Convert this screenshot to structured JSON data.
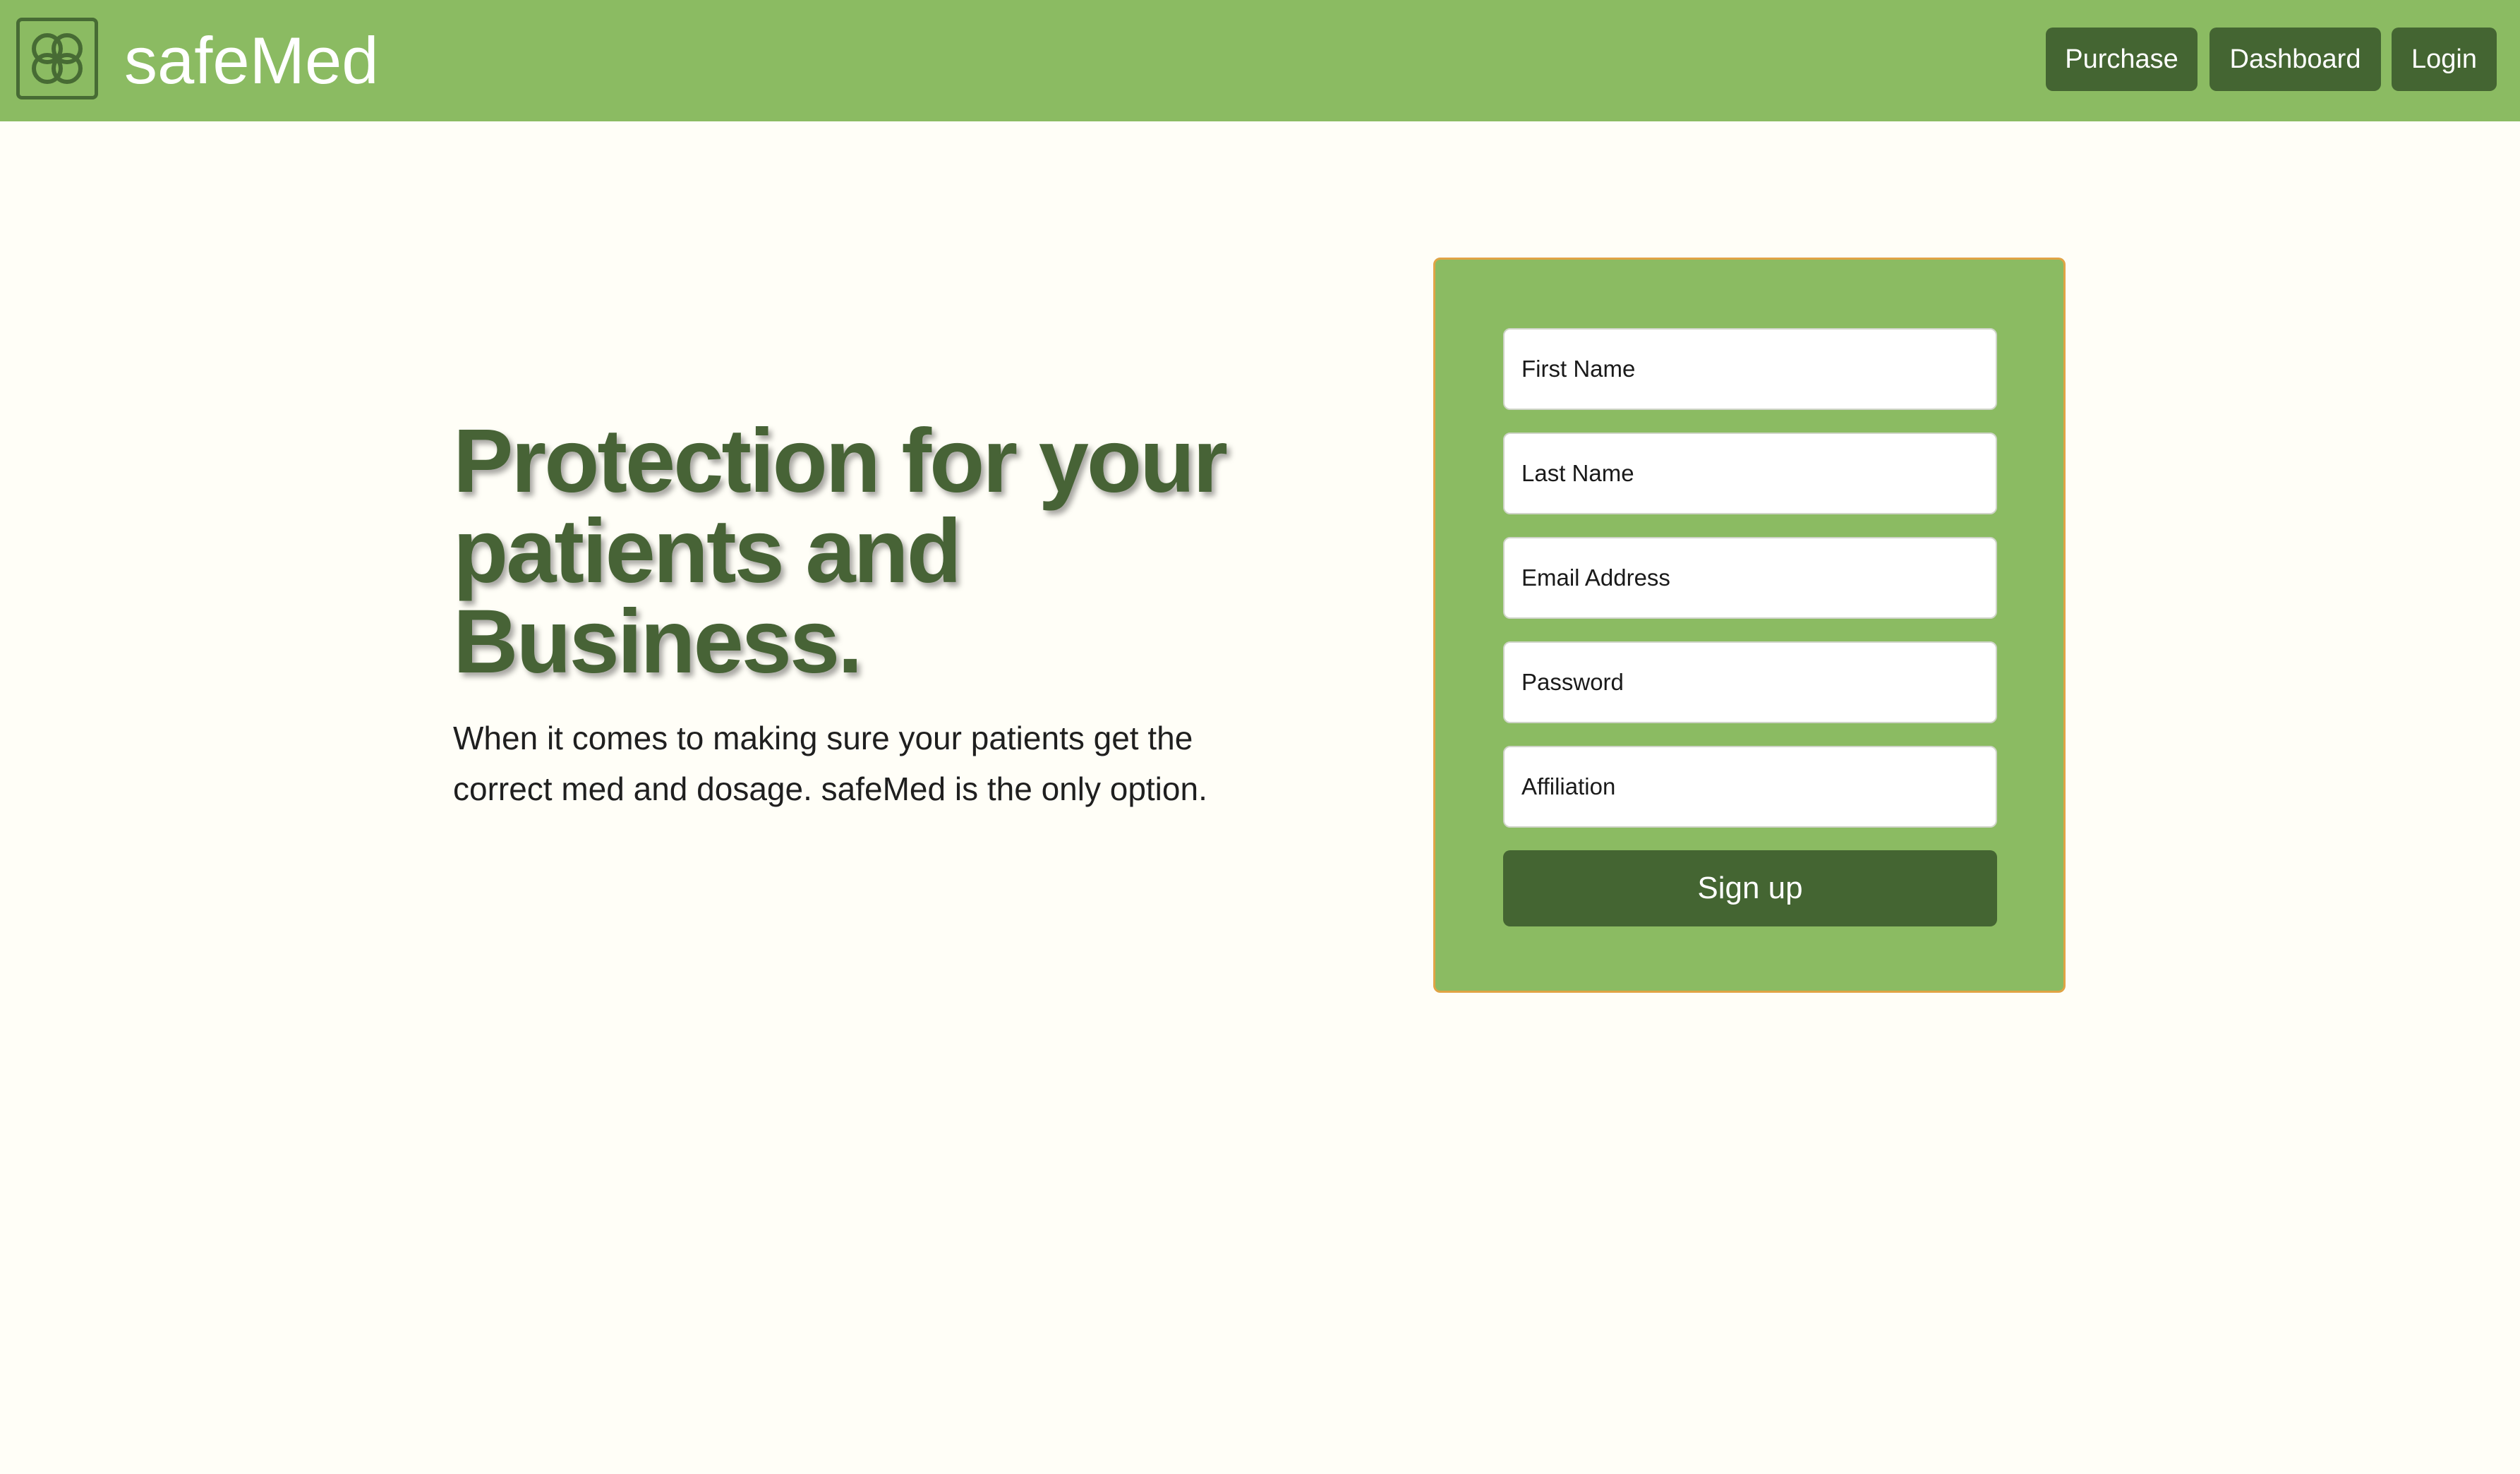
{
  "brand": {
    "name": "safeMed",
    "logo_icon": "clover-icon"
  },
  "nav": {
    "purchase_label": "Purchase",
    "dashboard_label": "Dashboard",
    "login_label": "Login"
  },
  "hero": {
    "title": "Protection for your patients and Business.",
    "subtitle": "When it comes to making sure your patients get the correct med and dosage. safeMed is the only option."
  },
  "signup_form": {
    "first_name_placeholder": "First Name",
    "last_name_placeholder": "Last Name",
    "email_placeholder": "Email Address",
    "password_placeholder": "Password",
    "affiliation_placeholder": "Affiliation",
    "submit_label": "Sign up"
  },
  "colors": {
    "nav_background": "#8bbb62",
    "accent_dark": "#446532",
    "page_background": "#fffef7",
    "card_border": "#e0a445"
  }
}
